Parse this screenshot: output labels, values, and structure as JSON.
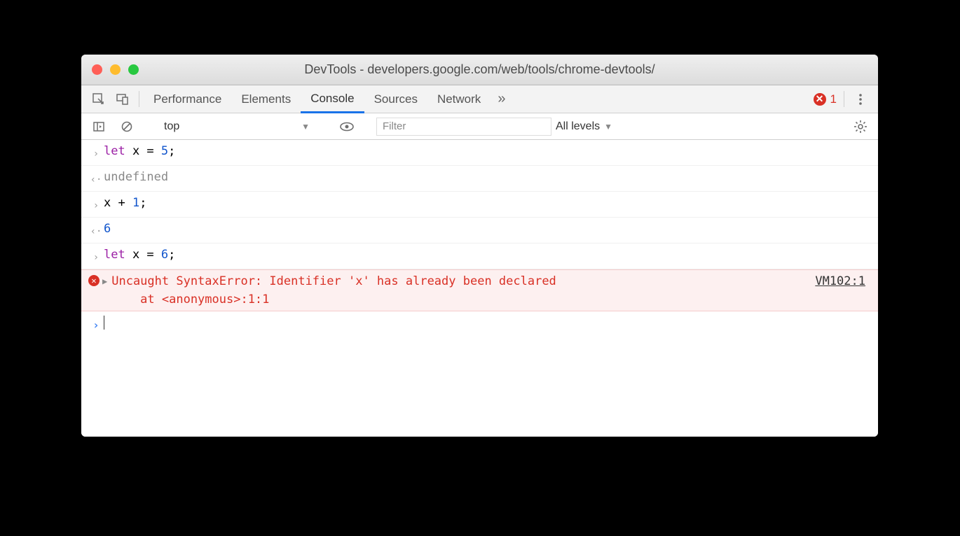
{
  "window": {
    "title": "DevTools - developers.google.com/web/tools/chrome-devtools/"
  },
  "tabs": {
    "performance": "Performance",
    "elements": "Elements",
    "console": "Console",
    "sources": "Sources",
    "network": "Network"
  },
  "errorBadge": {
    "count": "1"
  },
  "toolbar": {
    "context": "top",
    "filterPlaceholder": "Filter",
    "levelsLabel": "All levels"
  },
  "console": {
    "lines": [
      {
        "type": "input-let",
        "kw": "let",
        "rest": " x = ",
        "num": "5",
        "tail": ";"
      },
      {
        "type": "return-undef",
        "text": "undefined"
      },
      {
        "type": "input-plain",
        "text": "x + ",
        "num": "1",
        "tail": ";"
      },
      {
        "type": "return-num",
        "text": "6"
      },
      {
        "type": "input-let",
        "kw": "let",
        "rest": " x = ",
        "num": "6",
        "tail": ";"
      }
    ],
    "error": {
      "message": "Uncaught SyntaxError: Identifier 'x' has already been declared",
      "at": "    at <anonymous>:1:1",
      "source": "VM102:1"
    }
  }
}
